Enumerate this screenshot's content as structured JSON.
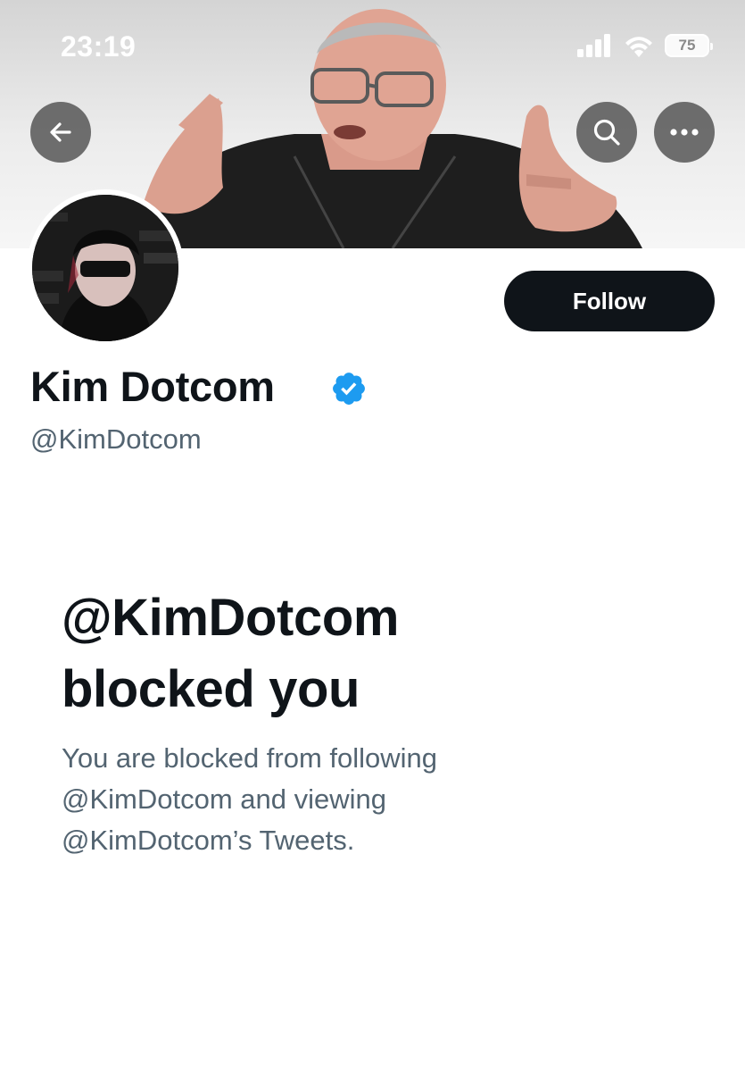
{
  "status_bar": {
    "time": "23:19",
    "battery": "75",
    "icons": [
      "signal-icon",
      "wifi-icon",
      "battery-icon"
    ]
  },
  "header": {
    "back_icon": "arrow-left-icon",
    "search_icon": "search-icon",
    "more_icon": "more-horizontal-icon"
  },
  "profile": {
    "display_name": "Kim Dotcom",
    "verified": true,
    "handle": "@KimDotcom",
    "follow_label": "Follow"
  },
  "blocked": {
    "title_line1": "@KimDotcom",
    "title_line2": "blocked you",
    "description_line1": "You are blocked from following",
    "description_line2": "@KimDotcom and viewing",
    "description_line3": "@KimDotcom’s Tweets."
  },
  "colors": {
    "primary_text": "#0f1419",
    "secondary_text": "#536471",
    "verified_blue": "#1d9bf0",
    "button_dark": "#0f1419"
  }
}
